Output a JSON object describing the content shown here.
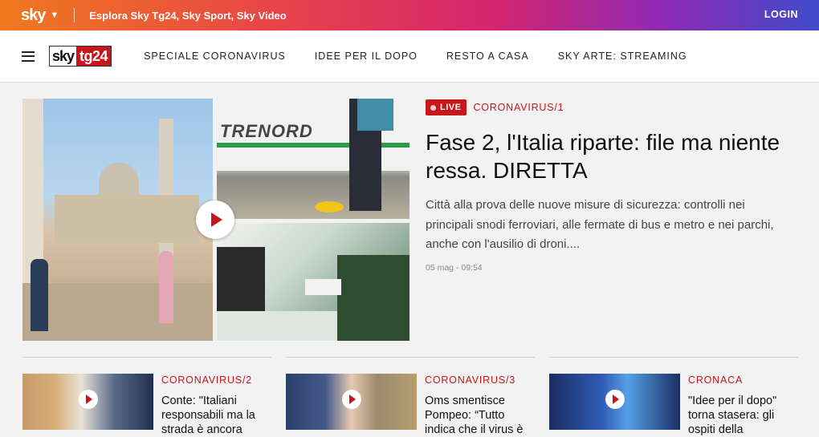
{
  "topbar": {
    "logo": "sky",
    "explore_label": "Esplora Sky Tg24, Sky Sport, Sky Video",
    "login_label": "LOGIN"
  },
  "nav": {
    "logo_sky": "sky",
    "logo_tg": "tg24",
    "items": [
      "SPECIALE CORONAVIRUS",
      "IDEE PER IL DOPO",
      "RESTO A CASA",
      "SKY ARTE: STREAMING"
    ]
  },
  "hero": {
    "live_label": "LIVE",
    "category": "CORONAVIRUS/1",
    "title": "Fase 2, l'Italia riparte: file ma niente ressa. DIRETTA",
    "description": "Città alla prova delle nuove misure di sicurezza: controlli nei principali snodi ferroviari, alle fermate di bus e metro e nei parchi, anche con l'ausilio di droni....",
    "timestamp": "05 mag - 09:54",
    "train_text": "TRENORD"
  },
  "cards": [
    {
      "category": "CORONAVIRUS/2",
      "title": "Conte: \"Italiani responsabili ma la strada è ancora"
    },
    {
      "category": "CORONAVIRUS/3",
      "title": "Oms smentisce Pompeo: “Tutto indica che il virus è"
    },
    {
      "category": "CRONACA",
      "title": "\"Idee per il dopo\" torna stasera: gli ospiti della"
    }
  ],
  "colors": {
    "brand_red": "#c8161d",
    "gradient": [
      "#f07a1e",
      "#e8414a",
      "#d6246e",
      "#8a2bb8",
      "#3f4bc9"
    ]
  }
}
